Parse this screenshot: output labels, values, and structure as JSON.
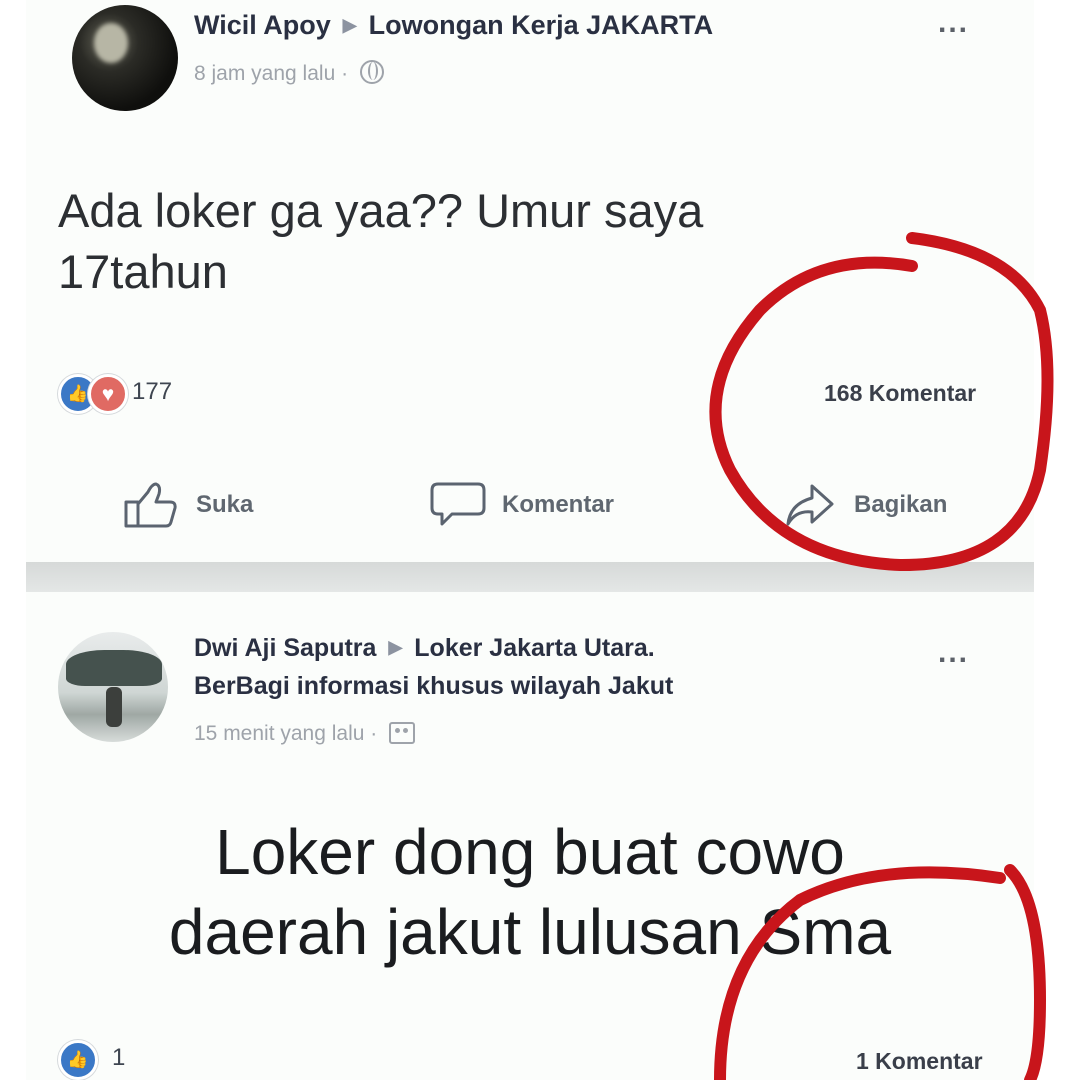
{
  "posts": [
    {
      "author": "Wicil Apoy",
      "group": "Lowongan Kerja JAKARTA",
      "time": "8 jam yang lalu",
      "privacy_icon": "globe-icon",
      "text": "Ada loker ga yaa?? Umur saya\n17tahun",
      "reactions": [
        "like",
        "love"
      ],
      "reaction_count": "177",
      "comment_count": "168 Komentar",
      "actions": {
        "like": "Suka",
        "comment": "Komentar",
        "share": "Bagikan"
      }
    },
    {
      "author": "Dwi Aji Saputra",
      "group": "Loker Jakarta Utara. BerBagi informasi khusus wilayah Jakut",
      "group_line1": "Loker Jakarta Utara.",
      "group_line2": "BerBagi informasi khusus wilayah Jakut",
      "time": "15 menit yang lalu",
      "privacy_icon": "group-icon",
      "text": "Loker dong buat cowo\ndaerah jakut lulusan Sma",
      "reactions": [
        "like"
      ],
      "reaction_count": "1",
      "comment_count": "1 Komentar"
    }
  ],
  "colors": {
    "like": "#3b78c6",
    "love": "#e06a63",
    "annotation": "#c8151b",
    "meta": "#9ea3aa"
  },
  "more_label": "..."
}
